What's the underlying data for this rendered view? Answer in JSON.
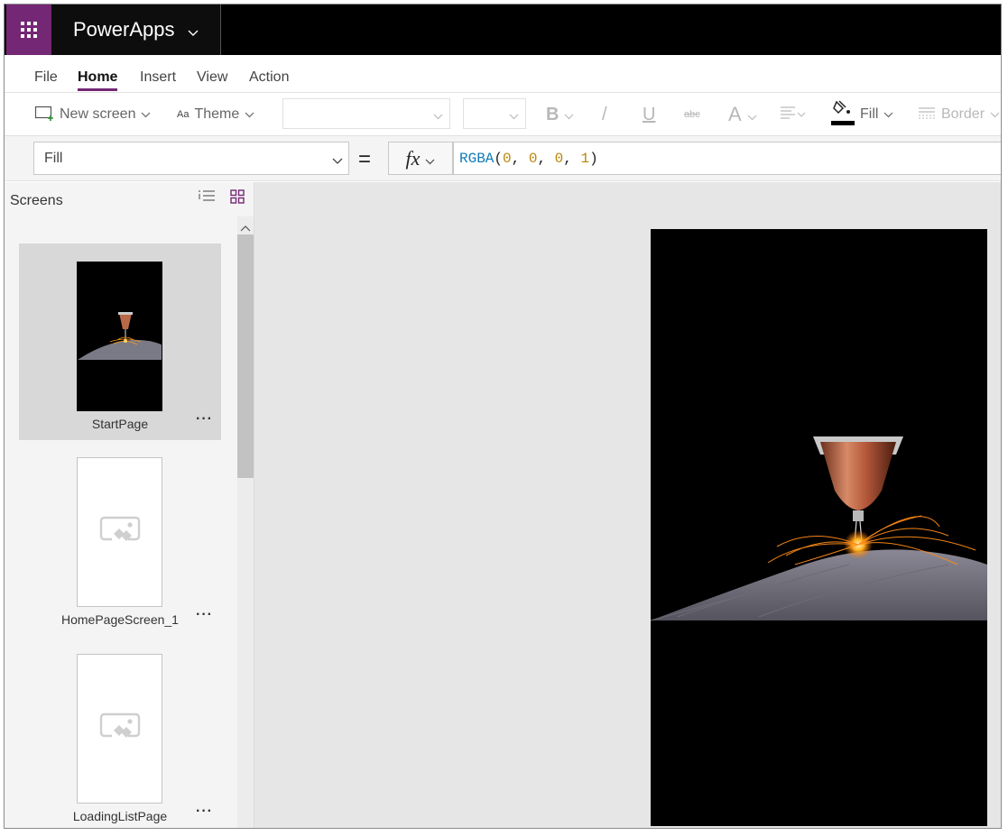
{
  "app": {
    "title": "PowerApps"
  },
  "menu": {
    "tabs": [
      "File",
      "Home",
      "Insert",
      "View",
      "Action"
    ],
    "active": "Home"
  },
  "ribbon": {
    "new_screen": "New screen",
    "theme": "Theme",
    "theme_icon_text": "Aa",
    "bold": "B",
    "italic": "/",
    "underline": "U",
    "strikethrough": "abc",
    "font_color": "A",
    "fill": "Fill",
    "border": "Border"
  },
  "formula_bar": {
    "property": "Fill",
    "equals": "=",
    "fx": "fx",
    "formula_fn": "RGBA",
    "formula_args": [
      "0",
      "0",
      "0",
      "1"
    ]
  },
  "screens_panel": {
    "title": "Screens",
    "screens": [
      {
        "name": "StartPage",
        "selected": true
      },
      {
        "name": "HomePageScreen_1",
        "selected": false
      },
      {
        "name": "LoadingListPage",
        "selected": false
      }
    ],
    "more": "···"
  },
  "colors": {
    "brand": "#742774",
    "topbar": "#000000",
    "selected_card": "#d8d8d8",
    "canvas_bg": "#e6e6e6",
    "screen_fill": "#000000"
  },
  "icons": [
    "waffle-icon",
    "chevron-down-icon",
    "new-screen-icon",
    "theme-icon",
    "fill-bucket-icon",
    "border-icon",
    "align-icon",
    "list-view-icon",
    "grid-view-icon",
    "placeholder-image-icon",
    "scroll-up-icon"
  ]
}
